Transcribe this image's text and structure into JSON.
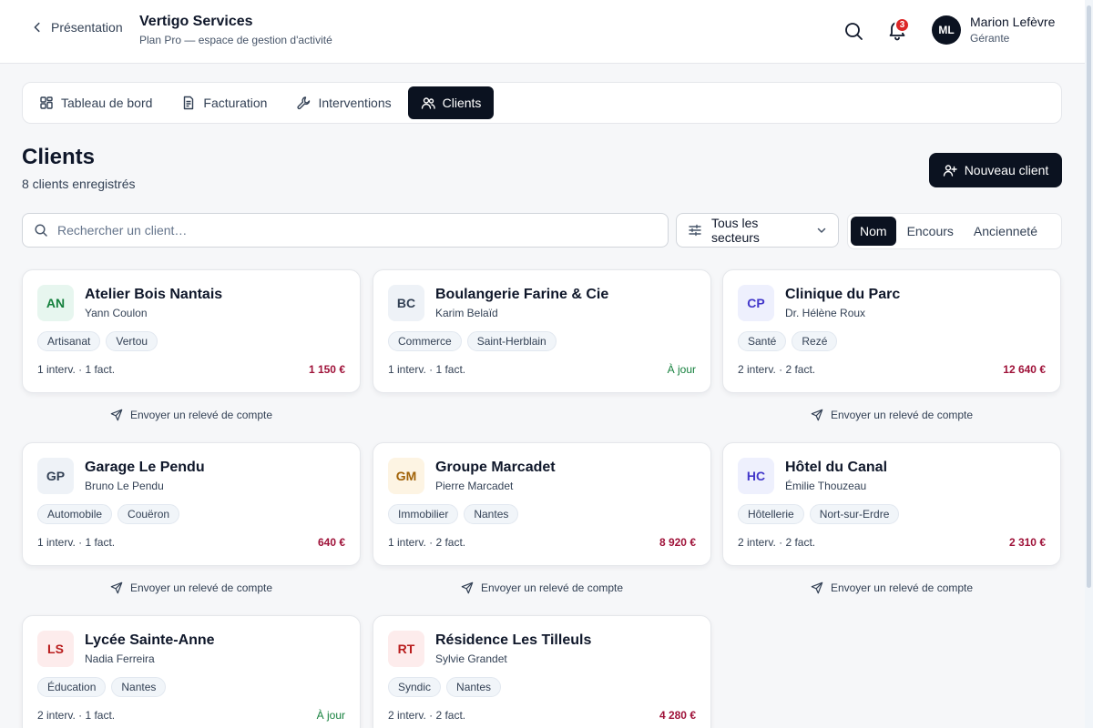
{
  "header": {
    "back_label": "Présentation",
    "brand_name": "Vertigo Services",
    "brand_sub": "Plan Pro — espace de gestion d'activité",
    "notif_count": "3",
    "user": {
      "initials": "ML",
      "name": "Marion Lefèvre",
      "role": "Gérante"
    }
  },
  "tabs": [
    {
      "label": "Tableau de bord",
      "icon": "dashboard-icon"
    },
    {
      "label": "Facturation",
      "icon": "invoice-icon"
    },
    {
      "label": "Interventions",
      "icon": "wrench-icon"
    },
    {
      "label": "Clients",
      "icon": "users-icon",
      "active": true
    }
  ],
  "page": {
    "title": "Clients",
    "subtitle": "8 clients enregistrés",
    "new_client_label": "Nouveau client"
  },
  "filters": {
    "search_placeholder": "Rechercher un client…",
    "sector_label": "Tous les secteurs",
    "sort_options": [
      "Nom",
      "Encours",
      "Ancienneté"
    ],
    "sort_active": "Nom"
  },
  "releve_label": "Envoyer un relevé de compte",
  "clients": [
    {
      "initials": "AN",
      "name": "Atelier Bois Nantais",
      "contact": "Yann Coulon",
      "tags": [
        "Artisanat",
        "Vertou"
      ],
      "stats": "1 interv. · 1 fact.",
      "amount": "1 150 €",
      "up_to_date": false,
      "releve": true,
      "bg": "#e7f6ef",
      "fg": "#15803d"
    },
    {
      "initials": "BC",
      "name": "Boulangerie Farine & Cie",
      "contact": "Karim Belaïd",
      "tags": [
        "Commerce",
        "Saint-Herblain"
      ],
      "stats": "1 interv. · 1 fact.",
      "amount": "À jour",
      "up_to_date": true,
      "releve": false,
      "bg": "#eef2f7",
      "fg": "#334155"
    },
    {
      "initials": "CP",
      "name": "Clinique du Parc",
      "contact": "Dr. Hélène Roux",
      "tags": [
        "Santé",
        "Rezé"
      ],
      "stats": "2 interv. · 2 fact.",
      "amount": "12 640 €",
      "up_to_date": false,
      "releve": true,
      "bg": "#eef0fd",
      "fg": "#4338ca"
    },
    {
      "initials": "GP",
      "name": "Garage Le Pendu",
      "contact": "Bruno Le Pendu",
      "tags": [
        "Automobile",
        "Couëron"
      ],
      "stats": "1 interv. · 1 fact.",
      "amount": "640 €",
      "up_to_date": false,
      "releve": true,
      "bg": "#eef2f7",
      "fg": "#334155"
    },
    {
      "initials": "GM",
      "name": "Groupe Marcadet",
      "contact": "Pierre Marcadet",
      "tags": [
        "Immobilier",
        "Nantes"
      ],
      "stats": "1 interv. · 2 fact.",
      "amount": "8 920 €",
      "up_to_date": false,
      "releve": true,
      "bg": "#fdf4e3",
      "fg": "#a16207"
    },
    {
      "initials": "HC",
      "name": "Hôtel du Canal",
      "contact": "Émilie Thouzeau",
      "tags": [
        "Hôtellerie",
        "Nort-sur-Erdre"
      ],
      "stats": "2 interv. · 2 fact.",
      "amount": "2 310 €",
      "up_to_date": false,
      "releve": true,
      "bg": "#eef0fd",
      "fg": "#4338ca"
    },
    {
      "initials": "LS",
      "name": "Lycée Sainte-Anne",
      "contact": "Nadia Ferreira",
      "tags": [
        "Éducation",
        "Nantes"
      ],
      "stats": "2 interv. · 1 fact.",
      "amount": "À jour",
      "up_to_date": true,
      "releve": false,
      "bg": "#fdecec",
      "fg": "#b91c1c"
    },
    {
      "initials": "RT",
      "name": "Résidence Les Tilleuls",
      "contact": "Sylvie Grandet",
      "tags": [
        "Syndic",
        "Nantes"
      ],
      "stats": "2 interv. · 2 fact.",
      "amount": "4 280 €",
      "up_to_date": false,
      "releve": true,
      "bg": "#fdecec",
      "fg": "#b91c1c"
    }
  ]
}
